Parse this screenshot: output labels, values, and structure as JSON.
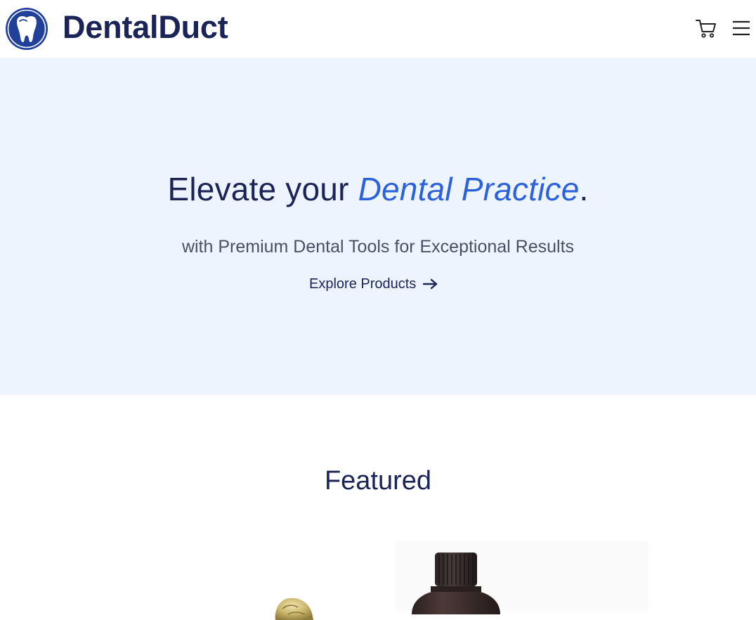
{
  "header": {
    "brand": "DentalDuct",
    "logo_icon": "tooth-logo-icon",
    "cart_icon": "cart-icon",
    "menu_icon": "hamburger-menu-icon"
  },
  "hero": {
    "title_prefix": "Elevate your ",
    "title_accent": "Dental Practice",
    "title_suffix": ".",
    "subtitle": "with Premium Dental Tools for Exceptional Results",
    "cta_label": "Explore Products",
    "cta_icon": "arrow-right-icon"
  },
  "featured": {
    "title": "Featured"
  },
  "colors": {
    "brand_navy": "#1b2457",
    "accent_blue": "#2b62dc",
    "hero_bg": "#eef4fe",
    "logo_blue": "#21409a"
  }
}
